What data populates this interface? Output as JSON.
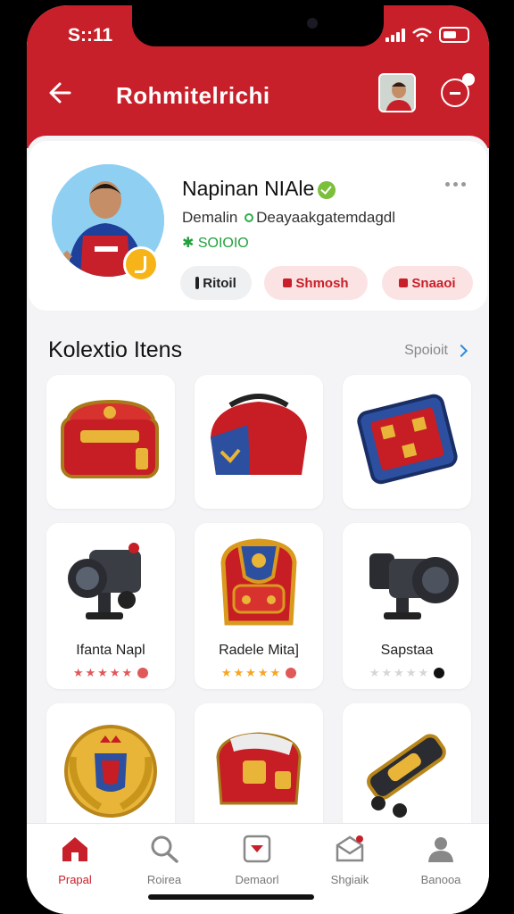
{
  "status_bar": {
    "time": "S::11"
  },
  "header": {
    "title": "Rohmitelrichi"
  },
  "profile": {
    "name": "Napinan NIAle",
    "subtitle_a": "Demalin",
    "subtitle_b": "Deayaakgatemdagdl",
    "points": "✱ SOIOIO",
    "buttons": [
      {
        "label": "Ritoil"
      },
      {
        "label": "Shmosh"
      },
      {
        "label": "Snaaoi"
      }
    ]
  },
  "collection": {
    "title": "Kolextio Itens",
    "link": "Spoioit",
    "items": [
      {
        "label": "",
        "stars": null
      },
      {
        "label": "",
        "stars": null
      },
      {
        "label": "",
        "stars": null
      },
      {
        "label": "Ifanta Napl",
        "rating": 5,
        "rating_color": "red"
      },
      {
        "label": "Radele Mita]",
        "rating": 5,
        "rating_color": "gold"
      },
      {
        "label": "Sapstaa",
        "rating": 0,
        "rating_color": "grey"
      }
    ]
  },
  "bottom_nav": [
    {
      "label": "Prapal",
      "icon": "home-icon"
    },
    {
      "label": "Roirea",
      "icon": "search-icon"
    },
    {
      "label": "Demaorl",
      "icon": "collection-icon"
    },
    {
      "label": "Shgiaik",
      "icon": "inbox-icon"
    },
    {
      "label": "Banooa",
      "icon": "profile-icon"
    }
  ],
  "colors": {
    "brand_red": "#c8202a",
    "star_gold": "#f5a623",
    "green": "#22a03c"
  }
}
